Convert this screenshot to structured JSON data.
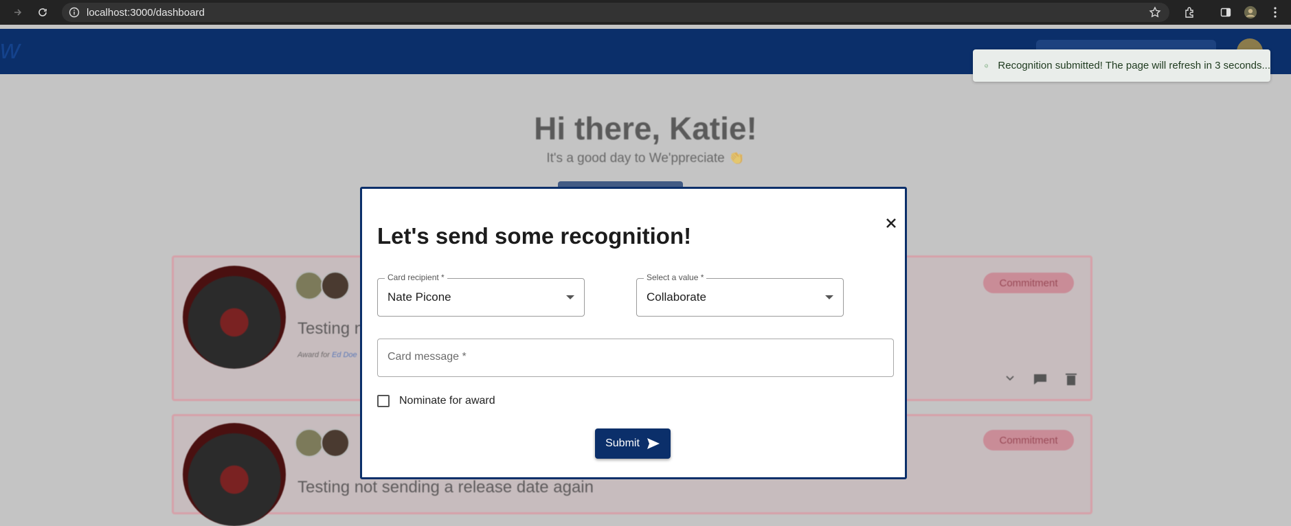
{
  "browser": {
    "url": "localhost:3000/dashboard"
  },
  "toast": {
    "message": "Recognition submitted! The page will refresh in 3 seconds..."
  },
  "dashboard": {
    "greeting": "Hi there, Katie!",
    "subgreeting": "It's a good day to We'ppreciate 👏",
    "cards": [
      {
        "title": "Testing n",
        "sub_prefix": "Award for",
        "sub_link": "Ed Doe",
        "badge": "Commitment"
      },
      {
        "title": "Testing not sending a release date again",
        "badge": "Commitment"
      }
    ]
  },
  "modal": {
    "title": "Let's send some recognition!",
    "recipient": {
      "label": "Card recipient *",
      "value": "Nate Picone"
    },
    "value_select": {
      "label": "Select a value *",
      "value": "Collaborate"
    },
    "message": {
      "placeholder": "Card message *"
    },
    "nominate_label": "Nominate for award",
    "submit_label": "Submit"
  },
  "colors": {
    "brand": "#0b2f6a",
    "toast_success": "#2e7d32",
    "badge_bg": "#c98c97"
  }
}
